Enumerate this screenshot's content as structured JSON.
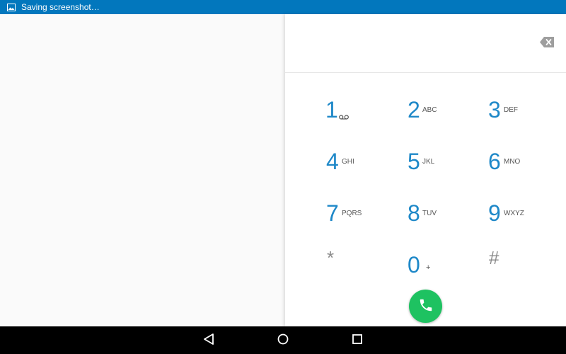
{
  "status_bar": {
    "notification_icon": "image-icon",
    "text": "Saving screenshot…",
    "background": "#0277bd"
  },
  "dialer": {
    "digits_value": "",
    "backspace_icon": "backspace-icon",
    "accent_color": "#1e88c8",
    "keys": [
      {
        "digit": "1",
        "letters": "",
        "extra_icon": "voicemail-icon"
      },
      {
        "digit": "2",
        "letters": "ABC"
      },
      {
        "digit": "3",
        "letters": "DEF"
      },
      {
        "digit": "4",
        "letters": "GHI"
      },
      {
        "digit": "5",
        "letters": "JKL"
      },
      {
        "digit": "6",
        "letters": "MNO"
      },
      {
        "digit": "7",
        "letters": "PQRS"
      },
      {
        "digit": "8",
        "letters": "TUV"
      },
      {
        "digit": "9",
        "letters": "WXYZ"
      },
      {
        "digit": "*",
        "letters": ""
      },
      {
        "digit": "0",
        "letters": "+"
      },
      {
        "digit": "#",
        "letters": ""
      }
    ],
    "call_button": {
      "icon": "phone-icon",
      "color": "#1ec261"
    }
  },
  "nav_bar": {
    "back_icon": "back-triangle-icon",
    "home_icon": "home-circle-icon",
    "recents_icon": "recents-square-icon"
  }
}
